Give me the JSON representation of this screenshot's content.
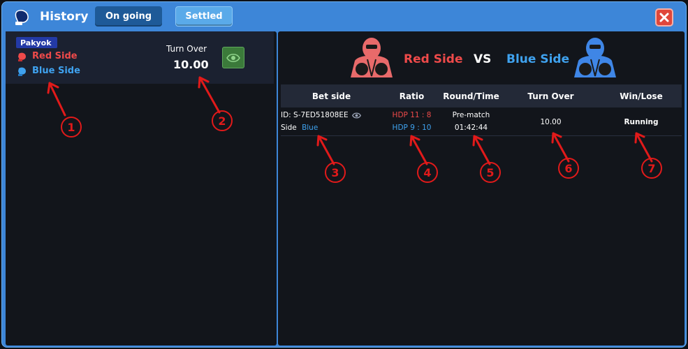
{
  "header": {
    "title": "History",
    "tabs": [
      {
        "label": "On going",
        "active": true
      },
      {
        "label": "Settled",
        "active": false
      }
    ]
  },
  "match": {
    "league": "Pakyok",
    "red_team": "Red Side",
    "blue_team": "Blue Side",
    "turnover_label": "Turn Over",
    "turnover_value": "10.00"
  },
  "versus": {
    "red": "Red Side",
    "vs": "VS",
    "blue": "Blue Side"
  },
  "table": {
    "headers": [
      "Bet side",
      "Ratio",
      "Round/Time",
      "Turn Over",
      "Win/Lose"
    ],
    "rows": [
      {
        "id": "ID: S-7ED51808EE",
        "side_label": "Side",
        "side_value": "Blue",
        "ratio_red": "HDP 11 : 8",
        "ratio_blue": "HDP 9 : 10",
        "round": "Pre-match",
        "time": "01:42:44",
        "turnover": "10.00",
        "result": "Running"
      }
    ]
  },
  "annotations": [
    "1",
    "2",
    "3",
    "4",
    "5",
    "6",
    "7"
  ],
  "colors": {
    "frame": "#3d86d8",
    "panel": "#12151b",
    "red": "#ee4a4a",
    "blue": "#3fa2ef",
    "annotation": "#e11a1a"
  }
}
